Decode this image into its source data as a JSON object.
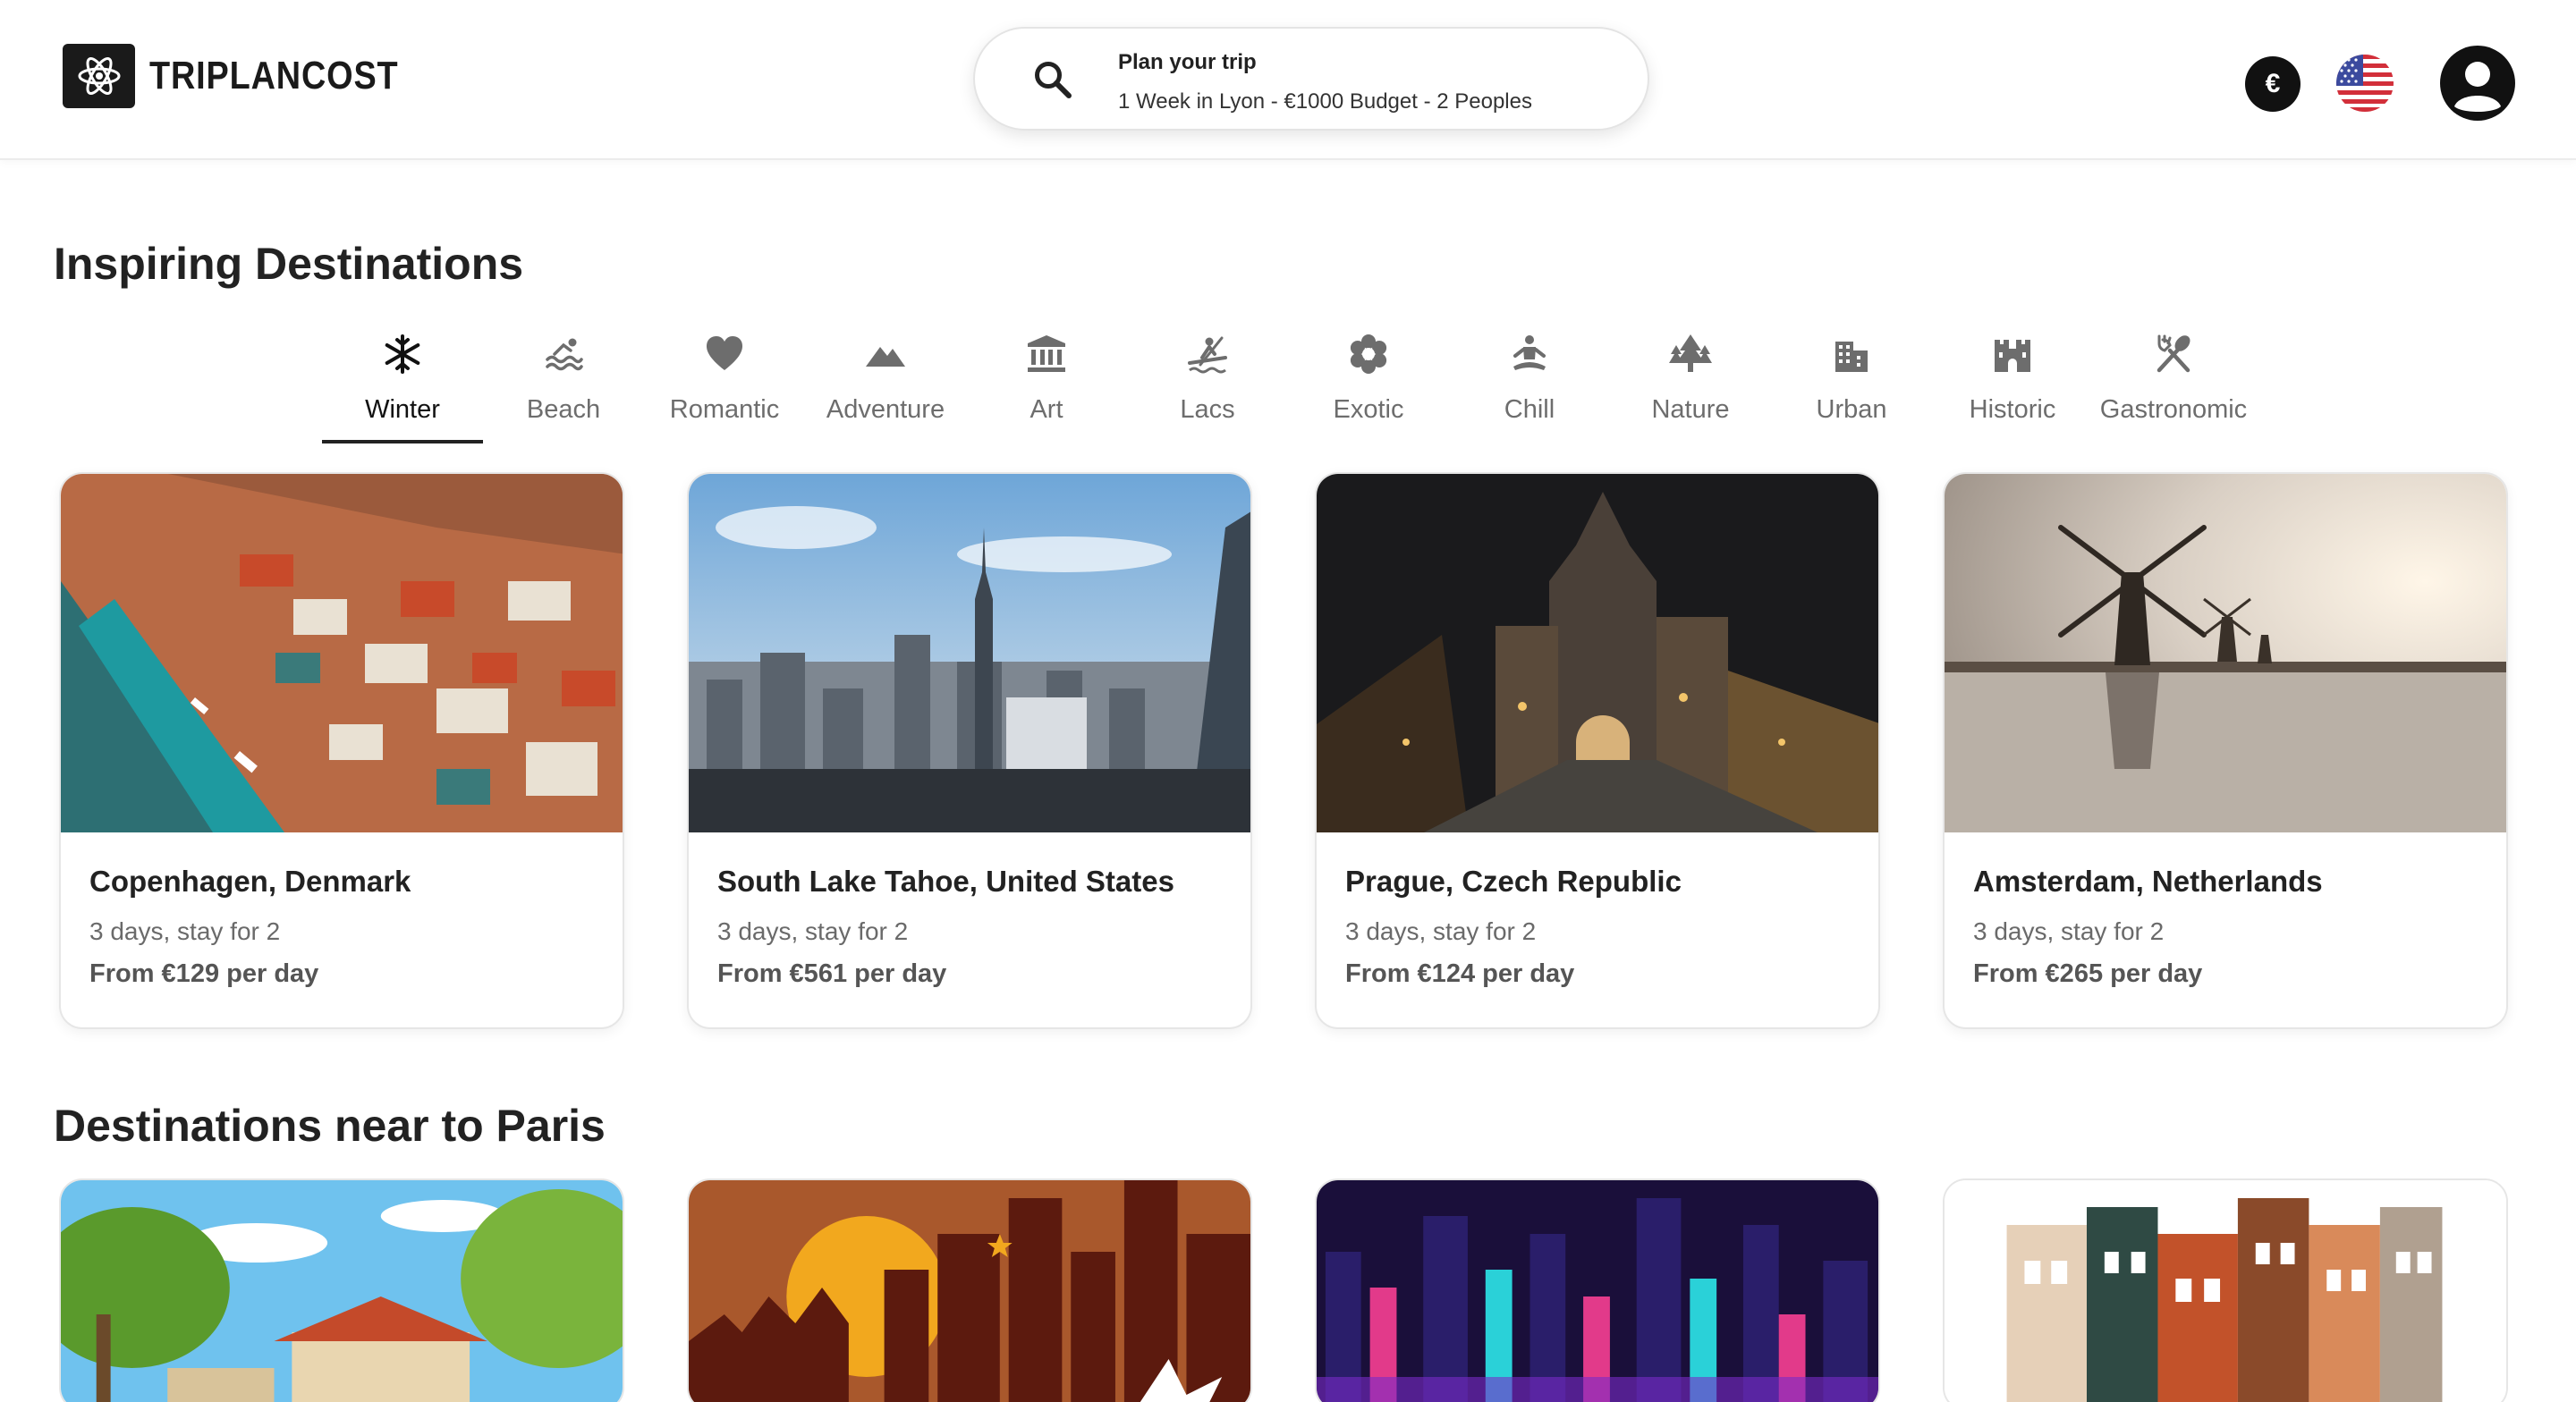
{
  "brand": {
    "name": "TRIPLANCOST"
  },
  "search": {
    "title": "Plan your trip",
    "summary": "1 Week in Lyon - €1000 Budget - 2 Peoples"
  },
  "header": {
    "currency_symbol": "€",
    "flag_icon": "us-flag-icon",
    "account_icon": "user-avatar-icon"
  },
  "sections": {
    "inspiring": {
      "title": "Inspiring Destinations"
    },
    "near": {
      "title": "Destinations near to Paris"
    }
  },
  "categories": [
    {
      "label": "Winter",
      "icon": "snowflake-icon",
      "active": true
    },
    {
      "label": "Beach",
      "icon": "swimming-icon",
      "active": false
    },
    {
      "label": "Romantic",
      "icon": "heart-icon",
      "active": false
    },
    {
      "label": "Adventure",
      "icon": "mountain-icon",
      "active": false
    },
    {
      "label": "Art",
      "icon": "museum-icon",
      "active": false
    },
    {
      "label": "Lacs",
      "icon": "kayak-icon",
      "active": false
    },
    {
      "label": "Exotic",
      "icon": "flower-icon",
      "active": false
    },
    {
      "label": "Chill",
      "icon": "meditation-icon",
      "active": false
    },
    {
      "label": "Nature",
      "icon": "trees-icon",
      "active": false
    },
    {
      "label": "Urban",
      "icon": "building-icon",
      "active": false
    },
    {
      "label": "Historic",
      "icon": "castle-icon",
      "active": false
    },
    {
      "label": "Gastronomic",
      "icon": "utensils-icon",
      "active": false
    }
  ],
  "destinations": [
    {
      "title": "Copenhagen, Denmark",
      "stay": "3 days, stay for 2",
      "price": "From €129 per day"
    },
    {
      "title": "South Lake Tahoe, United States",
      "stay": "3 days, stay for 2",
      "price": "From €561 per day"
    },
    {
      "title": "Prague, Czech Republic",
      "stay": "3 days, stay for 2",
      "price": "From €124 per day"
    },
    {
      "title": "Amsterdam, Netherlands",
      "stay": "3 days, stay for 2",
      "price": "From €265 per day"
    }
  ],
  "colors": {
    "accent": "#222222",
    "muted": "#6d6d6d",
    "border": "#e6e6e6"
  }
}
